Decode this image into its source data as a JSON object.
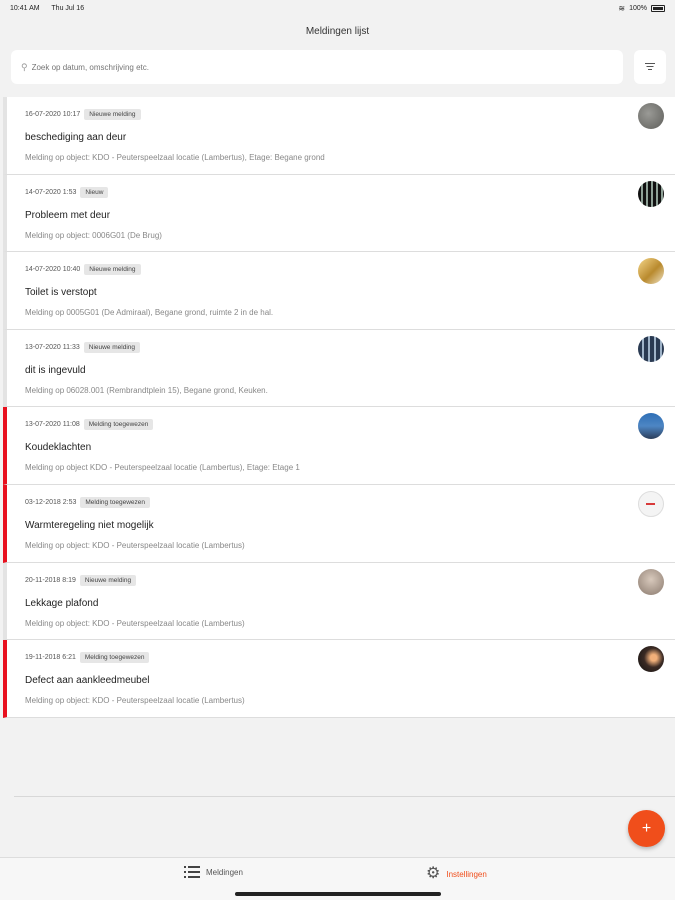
{
  "status_bar": {
    "time": "10:41 AM",
    "date": "Thu Jul 16",
    "battery": "100%"
  },
  "header": {
    "title": "Meldingen lijst"
  },
  "search": {
    "placeholder": "Zoek op datum, omschrijving etc."
  },
  "items": [
    {
      "date": "16-07-2020 10:17",
      "status": "Nieuwe melding",
      "title": "beschediging aan deur",
      "description": "Melding op object: KDO - Peuterspeelzaal locatie  (Lambertus), Etage: Begane grond",
      "urgent": false
    },
    {
      "date": "14-07-2020 1:53",
      "status": "Nieuw",
      "title": "Probleem met deur",
      "description": "Melding op object: 0006G01 (De Brug)",
      "urgent": false
    },
    {
      "date": "14-07-2020 10:40",
      "status": "Nieuwe melding",
      "title": "Toilet is verstopt",
      "description": "Melding op 0005G01 (De Admiraal), Begane grond, ruimte 2 in de hal.",
      "urgent": false
    },
    {
      "date": "13-07-2020 11:33",
      "status": "Nieuwe melding",
      "title": "dit is ingevuld",
      "description": "Melding op 06028.001 (Rembrandtplein 15), Begane grond, Keuken.",
      "urgent": false
    },
    {
      "date": "13-07-2020 11:08",
      "status": "Melding toegewezen",
      "title": "Koudeklachten",
      "description": "Melding op object KDO - Peuterspeelzaal locatie  (Lambertus), Etage: Etage 1",
      "urgent": true
    },
    {
      "date": "03-12-2018 2:53",
      "status": "Melding toegewezen",
      "title": "Warmteregeling niet mogelijk",
      "description": "Melding op object: KDO - Peuterspeelzaal locatie  (Lambertus)",
      "urgent": true
    },
    {
      "date": "20-11-2018 8:19",
      "status": "Nieuwe melding",
      "title": "Lekkage plafond",
      "description": "Melding op object: KDO - Peuterspeelzaal locatie  (Lambertus)",
      "urgent": false
    },
    {
      "date": "19-11-2018 6:21",
      "status": "Melding toegewezen",
      "title": "Defect aan aankleedmeubel",
      "description": "Melding op object: KDO - Peuterspeelzaal locatie  (Lambertus)",
      "urgent": true
    }
  ],
  "fab": {
    "label": "+"
  },
  "tabbar": {
    "meldingen": "Meldingen",
    "instellingen": "Instellingen"
  },
  "colors": {
    "accent": "#f04e1b",
    "urgent": "#e8101e"
  }
}
